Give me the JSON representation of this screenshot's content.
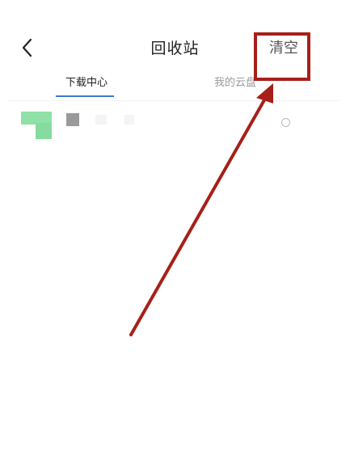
{
  "header": {
    "back_label": "",
    "title": "回收站",
    "clear_label": "清空"
  },
  "tabs": [
    {
      "label": "下载中心",
      "active": true
    },
    {
      "label": "我的云盘",
      "active": false
    }
  ],
  "accent_color": "#3a7ad9",
  "annotation": {
    "box_color": "#a62019",
    "arrow_color": "#a62019"
  },
  "list": {
    "items": [
      {
        "thumbnail_color": "#8fe1a7",
        "file_icon": "file-icon",
        "selected": false
      }
    ]
  }
}
